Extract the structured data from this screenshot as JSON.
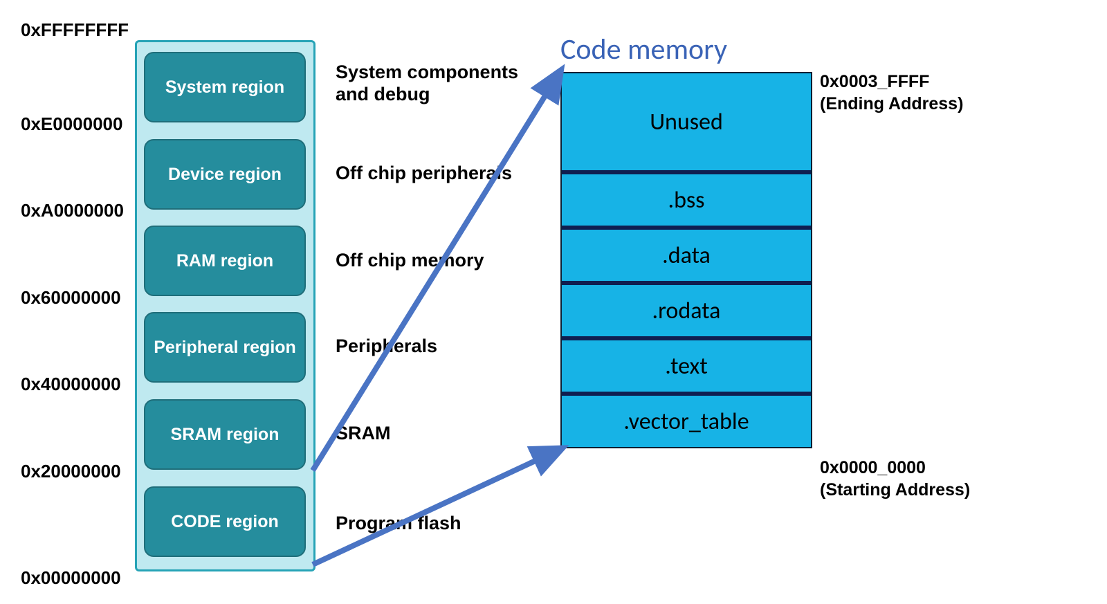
{
  "addresses": {
    "a0": "0xFFFFFFFF",
    "a1": "0xE0000000",
    "a2": "0xA0000000",
    "a3": "0x60000000",
    "a4": "0x40000000",
    "a5": "0x20000000",
    "a6": "0x00000000"
  },
  "regions": {
    "r0": "System region",
    "r1": "Device region",
    "r2": "RAM region",
    "r3": "Peripheral region",
    "r4": "SRAM region",
    "r5": "CODE  region"
  },
  "descriptions": {
    "d0a": "System components",
    "d0b": "and debug",
    "d1": "Off chip peripherals",
    "d2": "Off chip memory",
    "d3": "Peripherals",
    "d4": "SRAM",
    "d5": "Program flash"
  },
  "code_memory": {
    "title": "Code memory",
    "segments": {
      "s0": "Unused",
      "s1": ".bss",
      "s2": ".data",
      "s3": ".rodata",
      "s4": ".text",
      "s5": ".vector_table"
    },
    "end_addr": "0x0003_FFFF",
    "end_label": "(Ending Address)",
    "start_addr": "0x0000_0000",
    "start_label": "(Starting Address)"
  },
  "chart_data": {
    "type": "table",
    "memory_map": [
      {
        "region": "System region",
        "start": "0xE0000000",
        "end": "0xFFFFFFFF",
        "description": "System components and debug"
      },
      {
        "region": "Device region",
        "start": "0xA0000000",
        "end": "0xE0000000",
        "description": "Off chip peripherals"
      },
      {
        "region": "RAM region",
        "start": "0x60000000",
        "end": "0xA0000000",
        "description": "Off chip memory"
      },
      {
        "region": "Peripheral region",
        "start": "0x40000000",
        "end": "0x60000000",
        "description": "Peripherals"
      },
      {
        "region": "SRAM region",
        "start": "0x20000000",
        "end": "0x40000000",
        "description": "SRAM"
      },
      {
        "region": "CODE region",
        "start": "0x00000000",
        "end": "0x20000000",
        "description": "Program flash"
      }
    ],
    "code_memory_detail": {
      "start": "0x0000_0000",
      "end": "0x0003_FFFF",
      "segments_low_to_high": [
        ".vector_table",
        ".text",
        ".rodata",
        ".data",
        ".bss",
        "Unused"
      ]
    }
  }
}
